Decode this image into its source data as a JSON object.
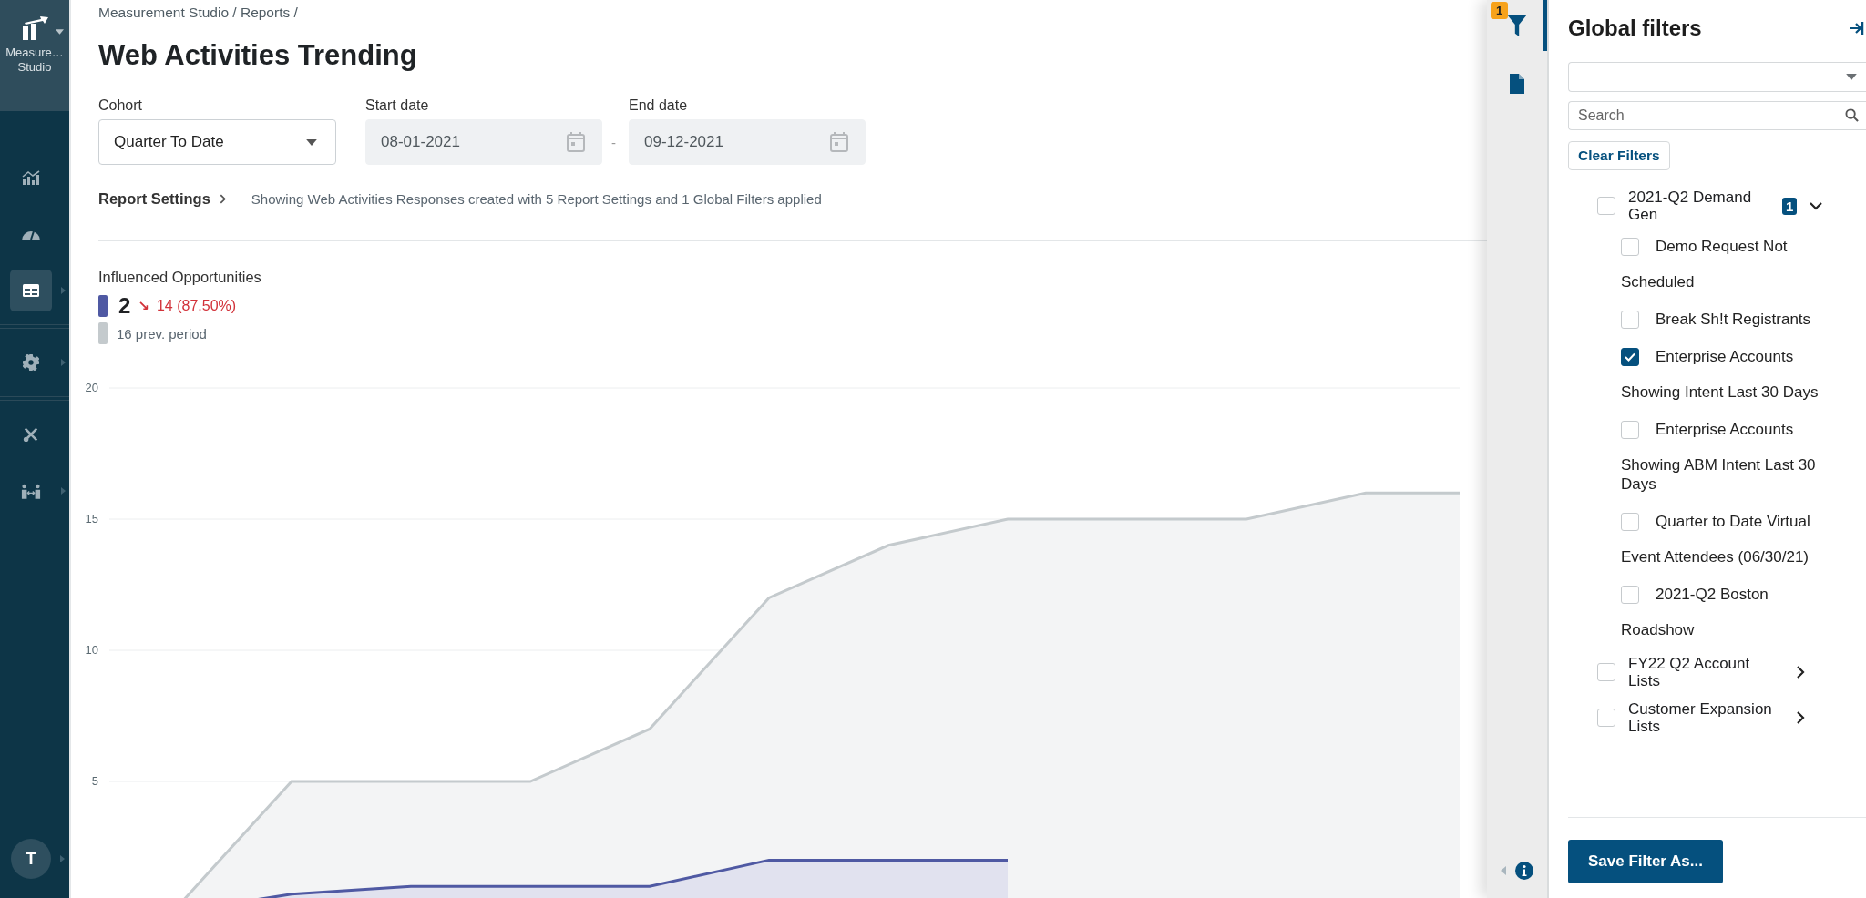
{
  "sidebar": {
    "app_name": "Measure… Studio",
    "items": [
      {
        "kind": "chart",
        "selected": false,
        "submenu": false
      },
      {
        "kind": "gauge",
        "selected": false,
        "submenu": false
      },
      {
        "kind": "table",
        "selected": true,
        "submenu": true
      },
      {
        "kind": "gear",
        "selected": false,
        "submenu": true
      },
      {
        "kind": "tools",
        "selected": false,
        "submenu": false
      },
      {
        "kind": "people",
        "selected": false,
        "submenu": true
      }
    ],
    "avatar": "T"
  },
  "breadcrumb": "Measurement Studio / Reports /",
  "title": "Web Activities Trending",
  "filters": {
    "cohort": {
      "label": "Cohort",
      "value": "Quarter To Date"
    },
    "start_date": {
      "label": "Start date",
      "value": "08-01-2021",
      "disabled": true
    },
    "date_separator": "-",
    "end_date": {
      "label": "End date",
      "value": "09-12-2021",
      "disabled": true
    }
  },
  "report_settings": {
    "label": "Report Settings",
    "summary": "Showing Web Activities Responses created with 5 Report Settings and 1 Global Filters applied"
  },
  "metric": {
    "title": "Influenced Opportunities",
    "current": {
      "color": "#4f59a3",
      "value": "2",
      "trend_icon": "↘",
      "change": "14 (87.50%)"
    },
    "previous": {
      "color": "#c4cacd",
      "label": "16 prev. period"
    },
    "y_tick_labels": [
      "20",
      "15",
      "10",
      "5"
    ]
  },
  "filter_panel": {
    "tabs": [
      {
        "kind": "filter",
        "selected": true,
        "badge": "1"
      },
      {
        "kind": "document",
        "selected": false
      }
    ],
    "title": "Global filters",
    "search": {
      "placeholder": "Search"
    },
    "clear_button": "Clear Filters",
    "tree": [
      {
        "label": "2021-Q2 Demand Gen",
        "checked": false,
        "badge": "1",
        "expanded": true,
        "children": [
          {
            "lines": [
              "Demo Request Not",
              "Scheduled"
            ],
            "checked": false
          },
          {
            "lines": [
              "Break Sh!t Registrants"
            ],
            "checked": false
          },
          {
            "lines": [
              "Enterprise Accounts",
              "Showing Intent Last 30 Days"
            ],
            "checked": true
          },
          {
            "lines": [
              "Enterprise Accounts",
              "Showing ABM Intent Last 30 Days"
            ],
            "checked": false
          },
          {
            "lines": [
              "Quarter to Date Virtual",
              "Event Attendees (06/30/21)"
            ],
            "checked": false
          },
          {
            "lines": [
              "2021-Q2 Boston",
              "Roadshow"
            ],
            "checked": false
          }
        ]
      },
      {
        "label": "FY22 Q2 Account Lists",
        "checked": false,
        "expanded": false
      },
      {
        "label": "Customer Expansion Lists",
        "checked": false,
        "expanded": false
      }
    ],
    "save_button": "Save Filter As..."
  }
}
